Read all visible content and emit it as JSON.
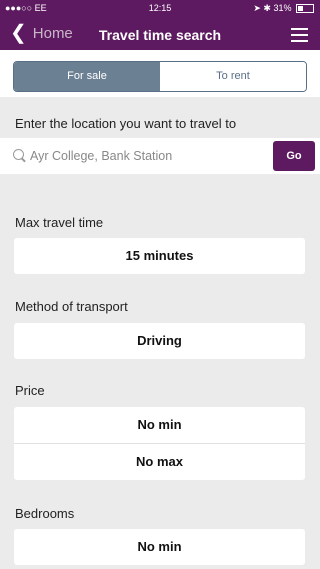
{
  "status": {
    "carrier": "●●●○○ EE",
    "time": "12:15",
    "battery": "31%"
  },
  "nav": {
    "back_label": "Home",
    "title": "Travel time search"
  },
  "segment": {
    "options": [
      "For sale",
      "To rent"
    ],
    "selected": "For sale"
  },
  "location": {
    "prompt": "Enter the location you want to travel to",
    "placeholder": "Ayr College, Bank Station",
    "go_label": "Go"
  },
  "max_travel_time": {
    "label": "Max travel time",
    "value": "15 minutes"
  },
  "transport": {
    "label": "Method of transport",
    "value": "Driving"
  },
  "price": {
    "label": "Price",
    "min": "No min",
    "max": "No max"
  },
  "bedrooms": {
    "label": "Bedrooms",
    "min": "No min"
  },
  "colors": {
    "brand": "#5e1a60",
    "segment_active": "#6c8094",
    "background": "#ebebeb"
  }
}
